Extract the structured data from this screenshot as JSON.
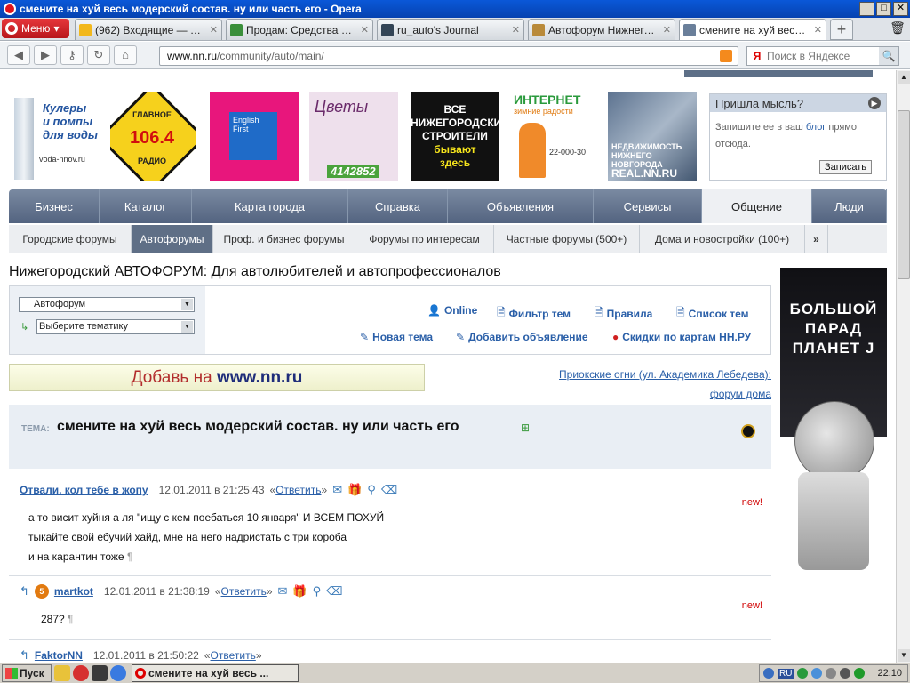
{
  "window": {
    "title": "смените на хуй весь модерский состав. ну или часть его - Opera",
    "min": "_",
    "max": "□",
    "close": "✕"
  },
  "menu_label": "Меню",
  "tabs": [
    {
      "label": "(962) Входящие — dv...",
      "color": "#f2b81c"
    },
    {
      "label": "Продам: Средства св...",
      "color": "#3a8f3a"
    },
    {
      "label": "ru_auto's Journal",
      "color": "#345"
    },
    {
      "label": "Автофорум Нижнего ...",
      "color": "#b98a3a"
    },
    {
      "label": "смените на хуй весь ...",
      "color": "#6a7f9a"
    }
  ],
  "newtab": "+",
  "trash": "🗑",
  "address": {
    "domain": "www.nn.ru",
    "path": "/community/auto/main/"
  },
  "search": {
    "engine": "Я",
    "placeholder": "Поиск в Яндексе",
    "go": "🔍"
  },
  "nav": {
    "back": "◀",
    "forward": "▶",
    "key": "⚷",
    "reload": "↻",
    "home": "⌂"
  },
  "banners": {
    "coolers": {
      "text1": "Кулеры",
      "text2": "и помпы",
      "text3": "для воды",
      "url": "voda-nnov.ru"
    },
    "radio": {
      "top": "ГЛАВНОЕ",
      "freq": "106.4",
      "bottom": "РАДИО"
    },
    "ef": {
      "line1": "English",
      "line2": "First"
    },
    "flowers": {
      "name": "Цветы",
      "phone": "4142852"
    },
    "builders": {
      "l1": "ВСЕ",
      "l2": "НИЖЕГОРОДСКИЕ",
      "l3": "СТРОИТЕЛИ",
      "l4": "бывают",
      "l5": "здесь"
    },
    "internet": {
      "head": "ИНТЕРНЕТ",
      "sub": "зимние радости",
      "phone": "22-000-30"
    },
    "realty": {
      "l1": "НЕДВИЖИМОСТЬ",
      "l2": "НИЖНЕГО НОВГОРОДА",
      "l3": "REAL.NN.RU"
    }
  },
  "idea_box": {
    "title": "Пришла мысль?",
    "text1": "Запишите ее в ваш",
    "link": "блог",
    "text2": "прямо",
    "text3": "отсюда.",
    "button": "Записать"
  },
  "main_nav": [
    {
      "label": "Бизнес",
      "w": 102
    },
    {
      "label": "Каталог",
      "w": 104
    },
    {
      "label": "Карта города",
      "w": 176
    },
    {
      "label": "Справка",
      "w": 112
    },
    {
      "label": "Объявления",
      "w": 164
    },
    {
      "label": "Сервисы",
      "w": 122
    },
    {
      "label": "Общение",
      "w": 124,
      "active": true
    },
    {
      "label": "Люди",
      "w": 84
    }
  ],
  "sub_nav": [
    {
      "label": "Городские форумы",
      "w": 138
    },
    {
      "label": "Автофорумы",
      "w": 92,
      "active": true
    },
    {
      "label": "Проф. и бизнес форумы",
      "w": 160
    },
    {
      "label": "Форумы по интересам",
      "w": 156
    },
    {
      "label": "Частные форумы (500+)",
      "w": 164
    },
    {
      "label": "Дома и новостройки (100+)",
      "w": 186
    },
    {
      "label": "»",
      "w": 26,
      "more": true
    }
  ],
  "page_title": "Нижегородский АВТОФОРУМ: Для автолюбителей и автопрофессионалов",
  "selects": {
    "forum": "Автофорум",
    "topic": "Выберите тематику"
  },
  "tools": {
    "online": "Online",
    "filter": "Фильтр тем",
    "rules": "Правила",
    "list": "Список тем",
    "new_topic": "Новая тема",
    "add_ad": "Добавить объявление",
    "discounts": "Скидки по картам НН.РУ"
  },
  "add_strip": {
    "prefix": "Добавь на ",
    "site": "www.nn.ru"
  },
  "promo": {
    "line1": "Приокские огни (ул. Академика Лебедева):",
    "line2": "форум дома"
  },
  "topic": {
    "label": "ТЕМА:",
    "text": "смените на хуй весь модерский состав. ну или часть его"
  },
  "posts": [
    {
      "author": "Отвали. кол тебе в жопу",
      "date": "12.01.2011 в 21:25:43",
      "reply": "Ответить",
      "new": "new!",
      "lines": [
        "а то висит хуйня а ля \"ищу с кем поебаться 10 января\" И ВСЕМ ПОХУЙ",
        "тыкайте свой ебучий хайд, мне на него надристать с три короба",
        "и на карантин тоже"
      ]
    },
    {
      "author": "martkot",
      "rank": "5",
      "date": "12.01.2011 в 21:38:19",
      "reply": "Ответить",
      "new": "new!",
      "lines": [
        "287?"
      ]
    },
    {
      "author": "FaktorNN",
      "date": "12.01.2011 в 21:50:22",
      "reply": "Ответить"
    }
  ],
  "pilcrow": "¶",
  "side_banner": {
    "l1": "БОЛЬШОЙ",
    "l2": "ПАРАД",
    "l3": "ПЛАНЕТ J"
  },
  "taskbar": {
    "start": "Пуск",
    "task": "смените на хуй весь ...",
    "lang": "RU",
    "clock": "22:10"
  }
}
